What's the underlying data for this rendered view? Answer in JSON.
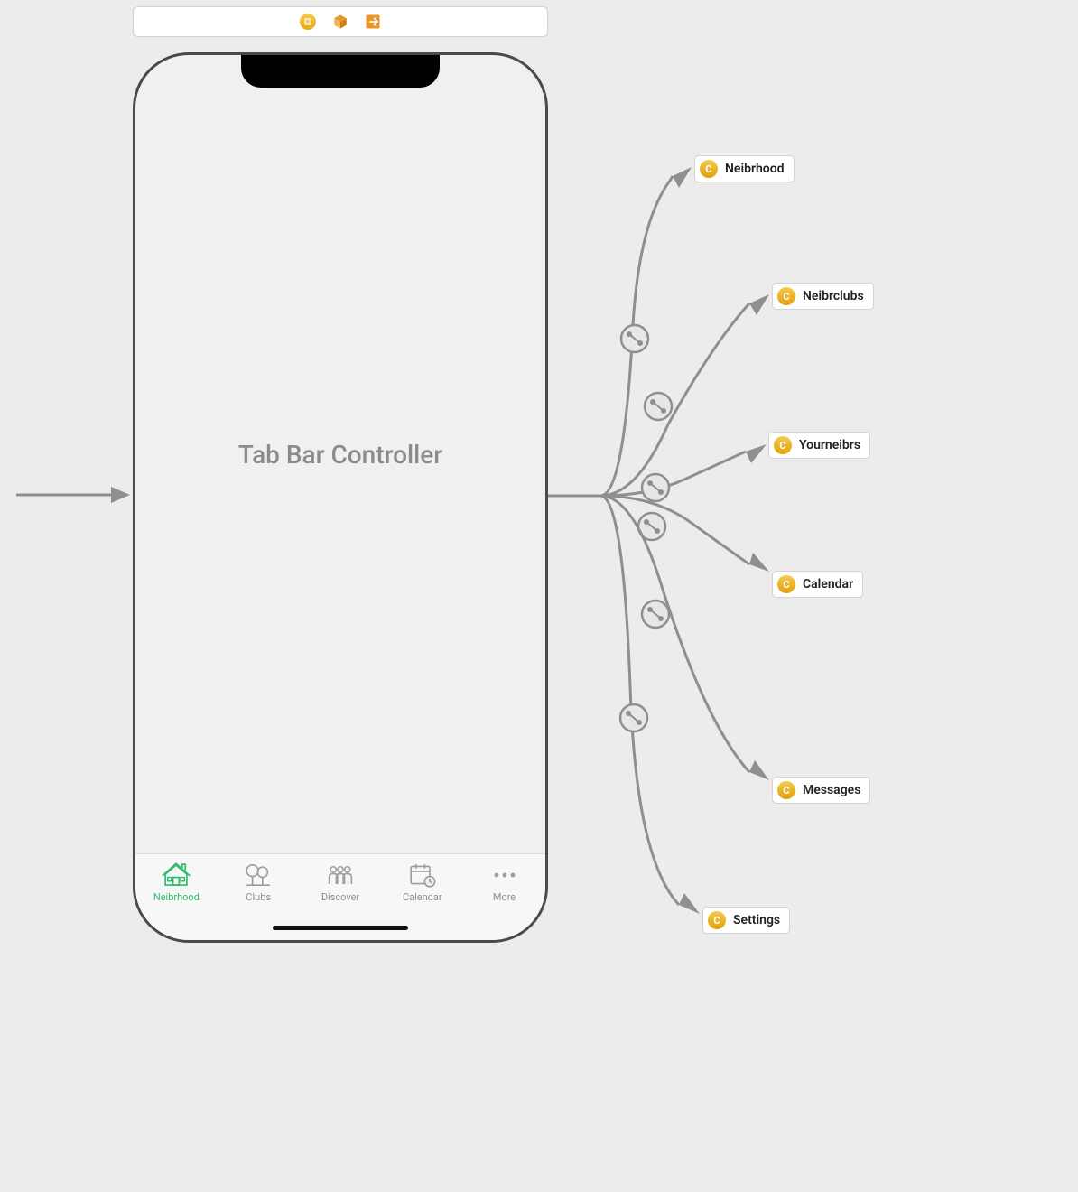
{
  "toolbar": {
    "icons": [
      "storyboard-icon",
      "scene-box-icon",
      "exit-icon"
    ]
  },
  "phone": {
    "centerLabel": "Tab Bar Controller"
  },
  "tabs": [
    {
      "label": "Neibrhood",
      "active": true
    },
    {
      "label": "Clubs",
      "active": false
    },
    {
      "label": "Discover",
      "active": false
    },
    {
      "label": "Calendar",
      "active": false
    },
    {
      "label": "More",
      "active": false
    }
  ],
  "destinations": [
    {
      "label": "Neibrhood"
    },
    {
      "label": "Neibrclubs"
    },
    {
      "label": "Yourneibrs"
    },
    {
      "label": "Calendar"
    },
    {
      "label": "Messages"
    },
    {
      "label": "Settings"
    }
  ]
}
